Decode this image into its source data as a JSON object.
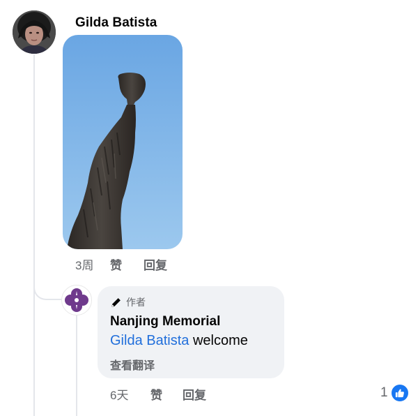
{
  "comment": {
    "author": "Gilda Batista",
    "timestamp": "3周",
    "like_label": "赞",
    "reply_label": "回复",
    "photo_icon": "statue-photo"
  },
  "reply": {
    "author_badge": "作者",
    "author": "Nanjing Memorial",
    "mention": "Gilda Batista",
    "text": " welcome",
    "translate_label": "查看翻译",
    "timestamp": "6天",
    "like_label": "赞",
    "reply_label": "回复",
    "reaction_count": "1",
    "reaction_icon": "thumbs-up-icon"
  },
  "colors": {
    "link": "#216fdb",
    "meta_text": "#65676b",
    "bubble_bg": "#f0f2f5",
    "like_blue": "#1877f2",
    "sky": "#7eb4e6",
    "avatar_purple": "#6f3a8c"
  }
}
